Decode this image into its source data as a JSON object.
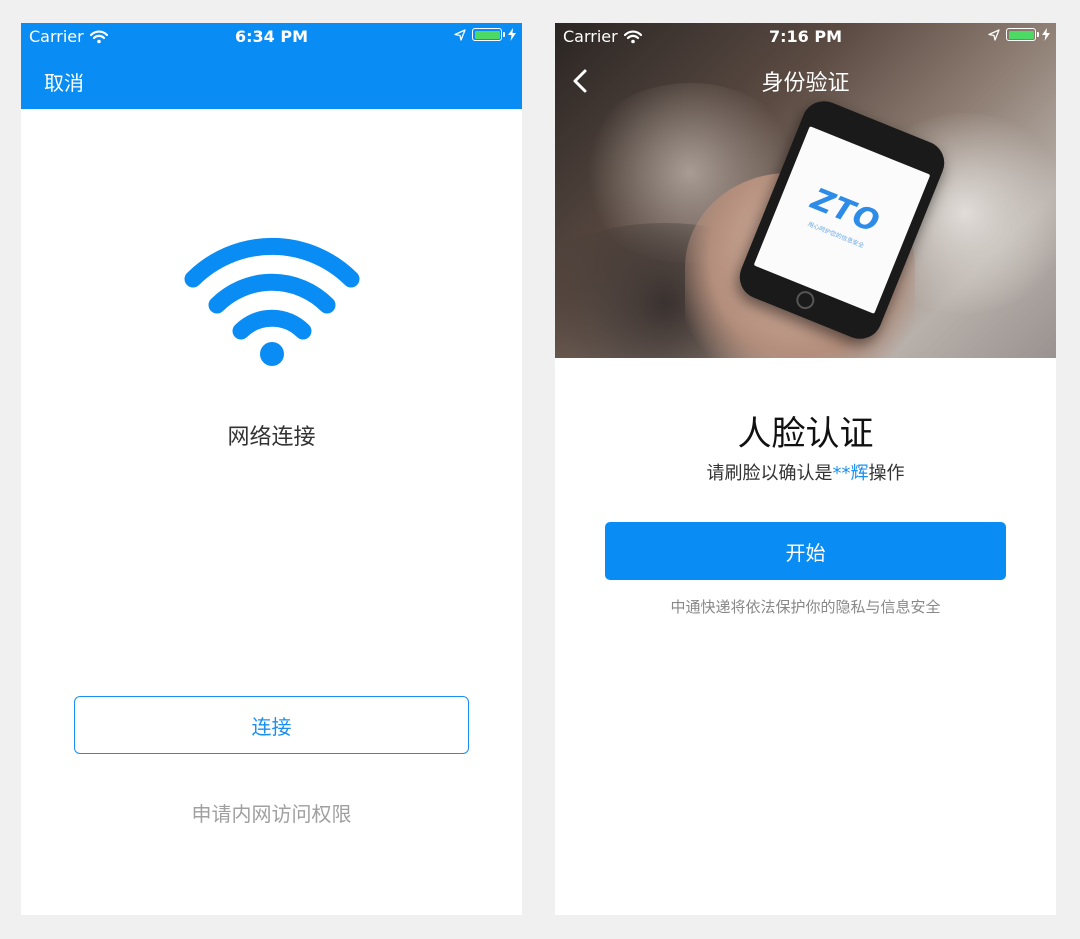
{
  "left_screen": {
    "status_bar": {
      "carrier": "Carrier",
      "time": "6:34 PM"
    },
    "nav": {
      "cancel_label": "取消"
    },
    "title": "网络连接",
    "connect_button": "连接",
    "apply_link": "申请内网访问权限",
    "accent_color": "#0a8cf5"
  },
  "right_screen": {
    "status_bar": {
      "carrier": "Carrier",
      "time": "7:16 PM"
    },
    "nav": {
      "title": "身份验证"
    },
    "hero": {
      "logo_text": "ZTO",
      "logo_subtext": "用心呵护您的信息安全"
    },
    "face_title": "人脸认证",
    "subtitle_prefix": "请刷脸以确认是",
    "subtitle_name": "**辉",
    "subtitle_suffix": "操作",
    "start_button": "开始",
    "privacy_text": "中通快递将依法保护你的隐私与信息安全",
    "accent_color": "#0a8cf5"
  },
  "icons": [
    "wifi-icon",
    "location-arrow-icon",
    "battery-icon",
    "charging-bolt-icon",
    "back-chevron-icon"
  ]
}
